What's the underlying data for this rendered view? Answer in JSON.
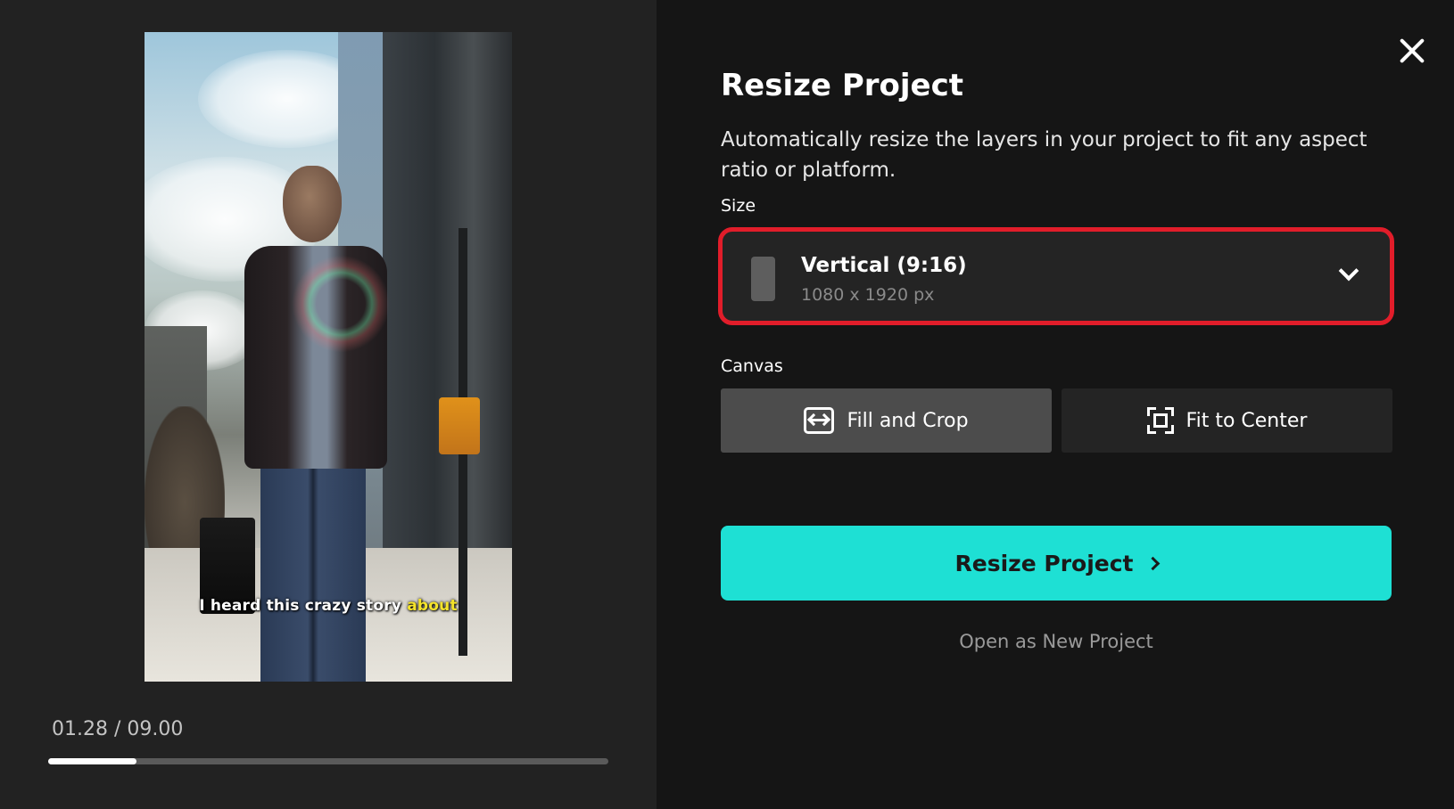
{
  "preview": {
    "caption_prefix": "I heard this crazy story ",
    "caption_highlight": "about",
    "timecode": "01.28 / 09.00",
    "progress": 0.158
  },
  "dialog": {
    "title": "Resize Project",
    "description": "Automatically resize the layers in your project to fit any aspect ratio or platform.",
    "size_label": "Size",
    "size_selected": {
      "name": "Vertical (9:16)",
      "dimensions": "1080 x 1920 px"
    },
    "canvas_label": "Canvas",
    "canvas_options": [
      {
        "label": "Fill and Crop",
        "icon": "fill-crop-icon",
        "selected": true
      },
      {
        "label": "Fit to Center",
        "icon": "fit-center-icon",
        "selected": false
      }
    ],
    "primary_button": "Resize Project",
    "secondary_link": "Open as New Project"
  },
  "colors": {
    "accent": "#1ee0d4",
    "highlight_ring": "#e11d2a",
    "caption_highlight": "#f4e32b",
    "panel_left": "#222222",
    "panel_right": "#151515"
  }
}
